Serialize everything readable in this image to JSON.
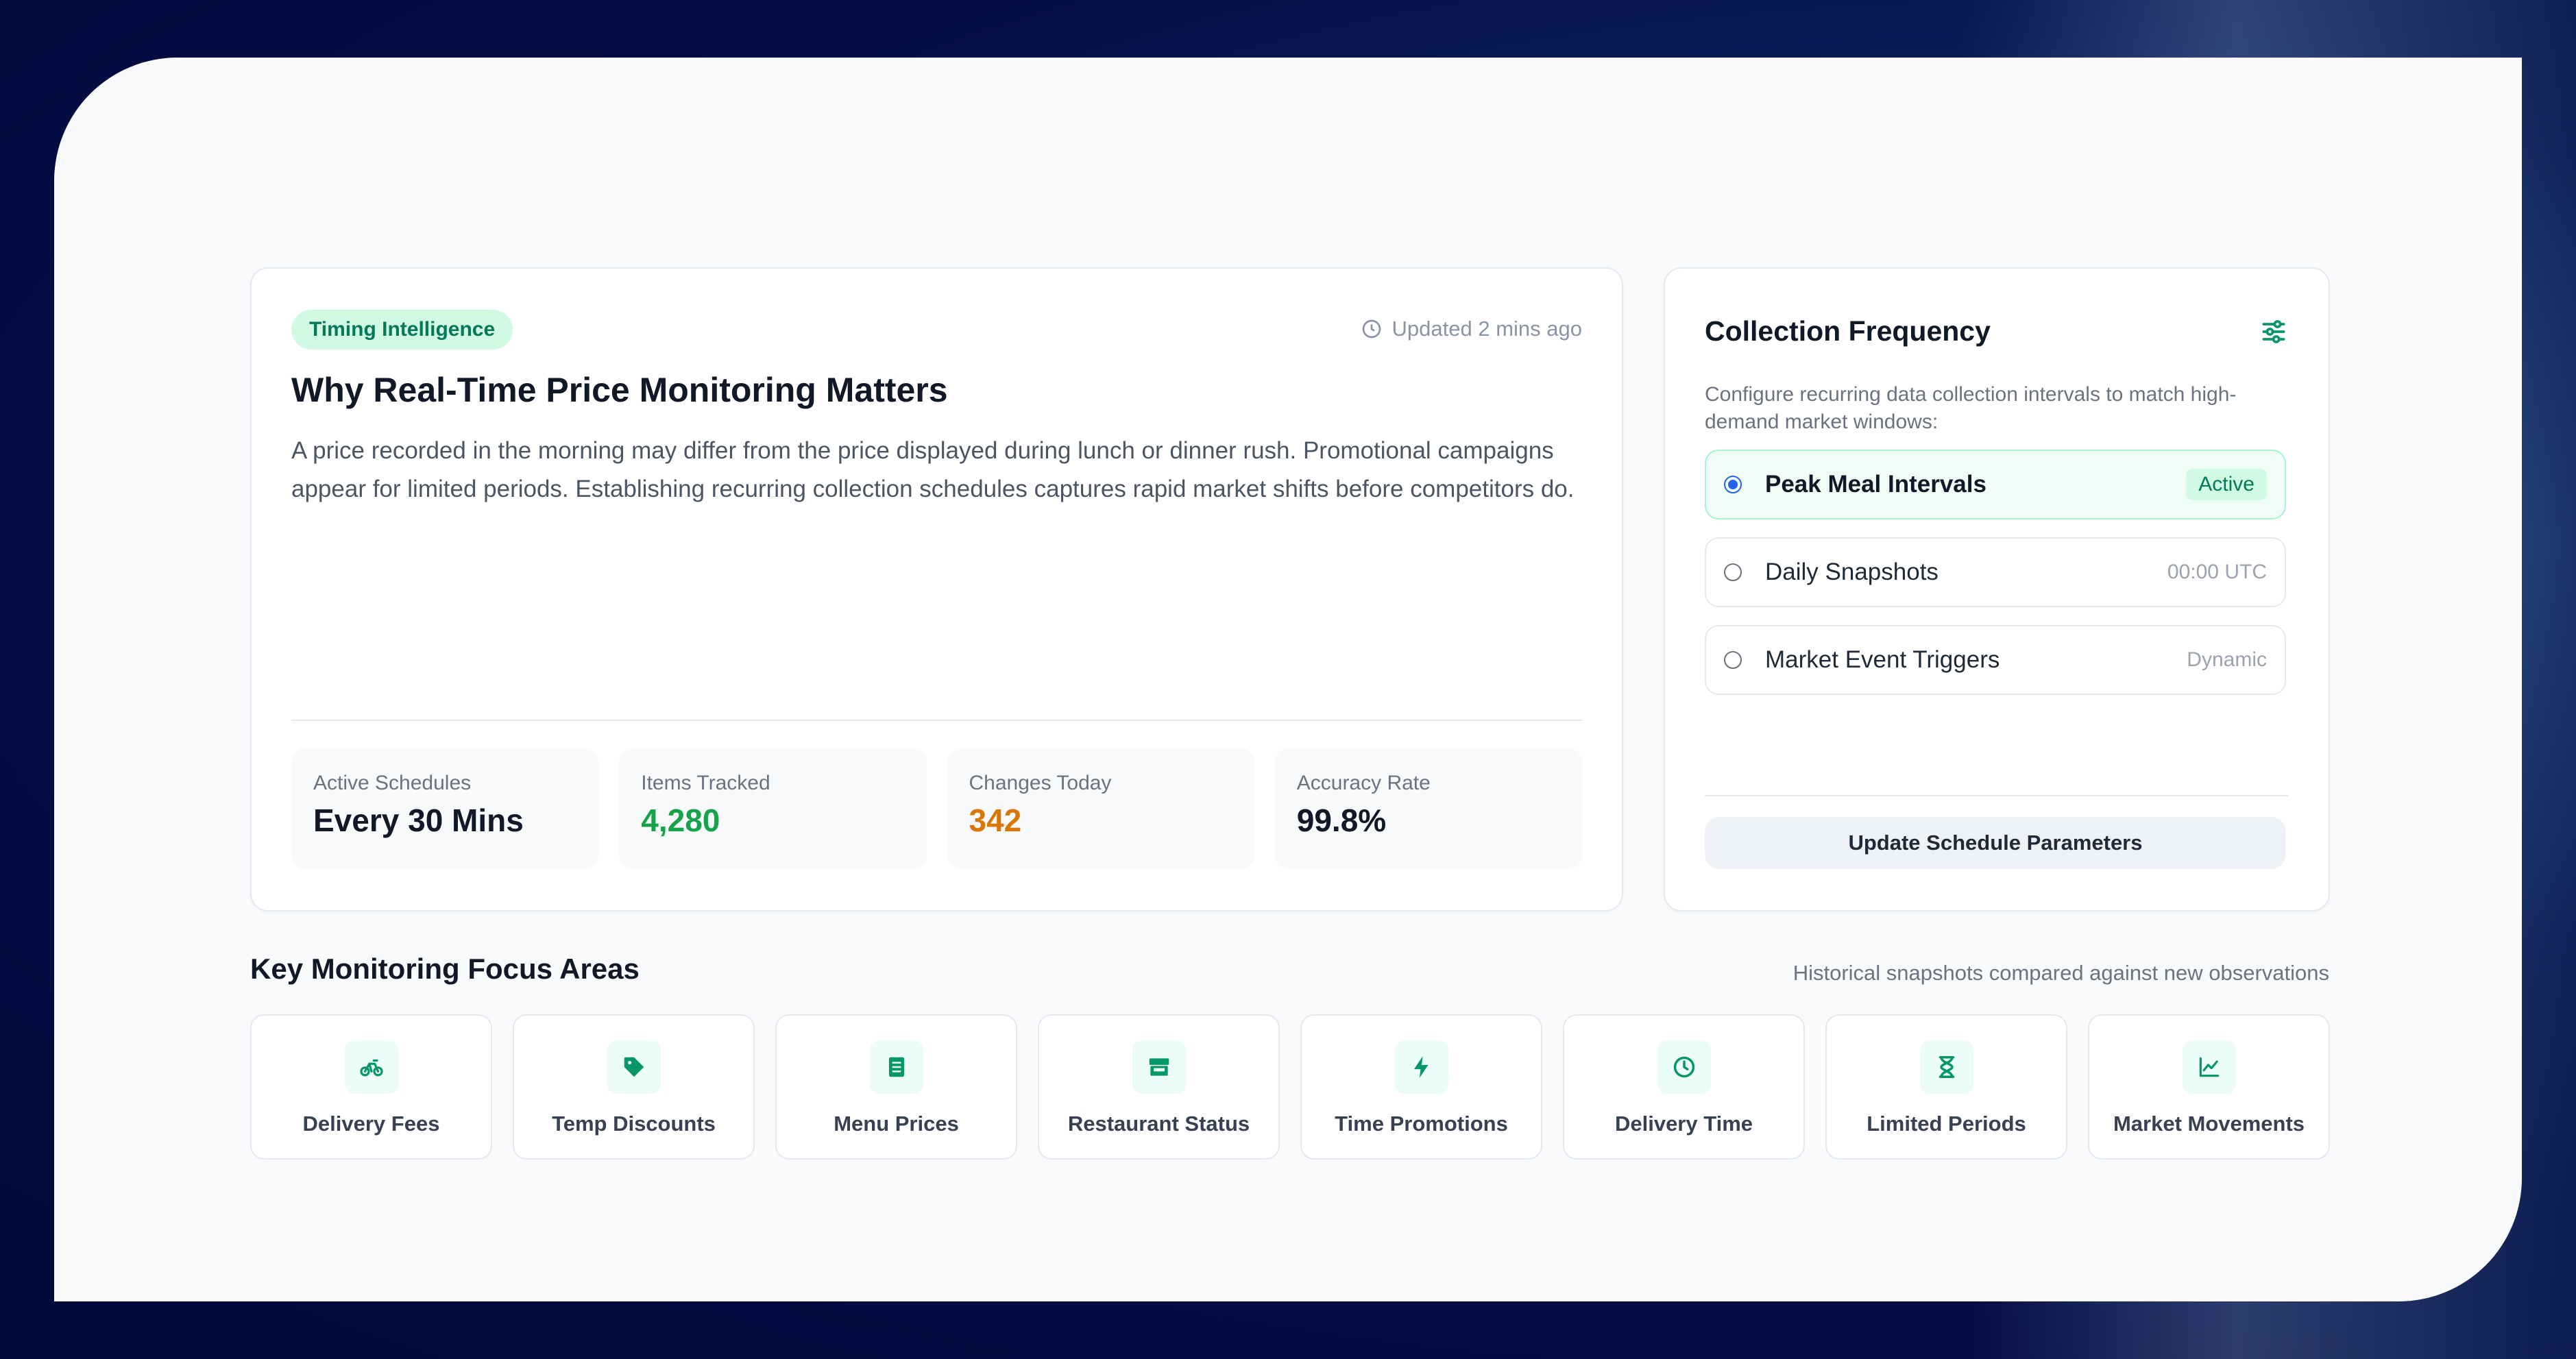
{
  "colors": {
    "accent_green": "#16a34a",
    "accent_orange": "#d97706",
    "tag_bg": "#d1fae5",
    "tag_text": "#047857",
    "radio_blue": "#2563eb"
  },
  "overview": {
    "tag": "Timing Intelligence",
    "updated": "Updated 2 mins ago",
    "updated_icon": "clock-icon",
    "title": "Why Real-Time Price Monitoring Matters",
    "description": "A price recorded in the morning may differ from the price displayed during lunch or dinner rush. Promotional campaigns appear for limited periods. Establishing recurring collection schedules captures rapid market shifts before competitors do.",
    "stats": [
      {
        "label": "Active Schedules",
        "value": "Every 30 Mins"
      },
      {
        "label": "Items Tracked",
        "value": "4,280"
      },
      {
        "label": "Changes Today",
        "value": "342"
      },
      {
        "label": "Accuracy Rate",
        "value": "99.8%"
      }
    ]
  },
  "frequency": {
    "title": "Collection Frequency",
    "settings_icon": "sliders-icon",
    "description": "Configure recurring data collection intervals to match high-demand market windows:",
    "options": [
      {
        "label": "Peak Meal Intervals",
        "meta": "Active",
        "selected": true
      },
      {
        "label": "Daily Snapshots",
        "meta": "00:00 UTC",
        "selected": false
      },
      {
        "label": "Market Event Triggers",
        "meta": "Dynamic",
        "selected": false
      }
    ],
    "button": "Update Schedule Parameters"
  },
  "focus": {
    "title": "Key Monitoring Focus Areas",
    "note": "Historical snapshots compared against new observations",
    "items": [
      {
        "label": "Delivery Fees",
        "icon": "bicycle-icon"
      },
      {
        "label": "Temp Discounts",
        "icon": "tag-icon"
      },
      {
        "label": "Menu Prices",
        "icon": "menu-list-icon"
      },
      {
        "label": "Restaurant Status",
        "icon": "store-icon"
      },
      {
        "label": "Time Promotions",
        "icon": "lightning-icon"
      },
      {
        "label": "Delivery Time",
        "icon": "clock-icon"
      },
      {
        "label": "Limited Periods",
        "icon": "hourglass-icon"
      },
      {
        "label": "Market Movements",
        "icon": "line-chart-icon"
      }
    ]
  }
}
